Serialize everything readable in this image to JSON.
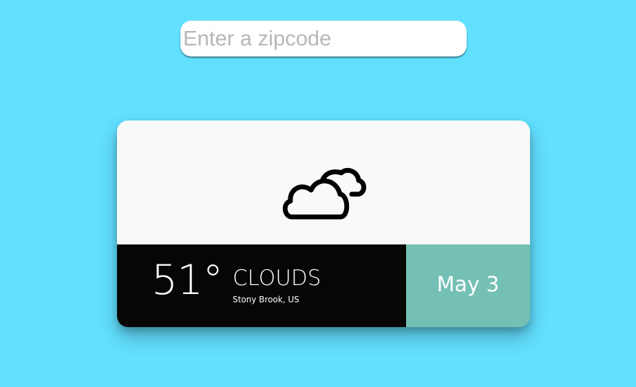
{
  "search": {
    "placeholder": "Enter a zipcode",
    "value": ""
  },
  "weather": {
    "icon": "clouds-icon",
    "temperature": "51°",
    "condition": "CLOUDS",
    "location": "Stony Brook, US",
    "date": "May 3"
  },
  "colors": {
    "background": "#62e0ff",
    "card_top": "#f9f9f9",
    "info_panel": "#080605",
    "date_panel": "#74c0b4"
  }
}
